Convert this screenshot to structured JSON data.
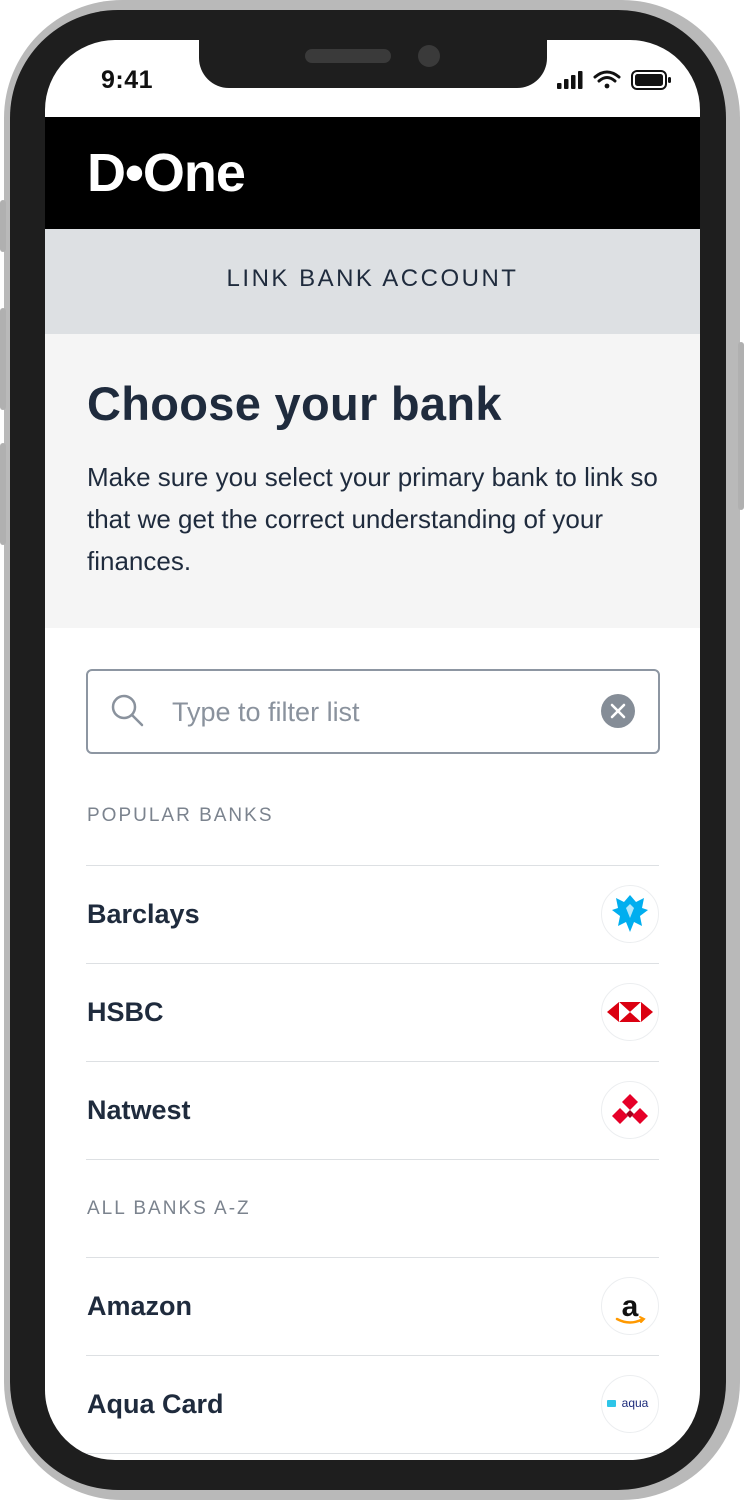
{
  "status_bar": {
    "time": "9:41"
  },
  "header": {
    "logo_text": "D•One"
  },
  "sub_header": {
    "title": "LINK BANK ACCOUNT"
  },
  "intro": {
    "heading": "Choose your bank",
    "body": "Make sure you select your primary bank to link so that we get the correct understanding of your finances."
  },
  "search": {
    "placeholder": "Type to filter list",
    "value": ""
  },
  "popular": {
    "label": "POPULAR BANKS",
    "banks": [
      {
        "name": "Barclays",
        "logo": "barclays-eagle-icon",
        "color": "#00aeef"
      },
      {
        "name": "HSBC",
        "logo": "hsbc-hexagon-icon",
        "color": "#db0011"
      },
      {
        "name": "Natwest",
        "logo": "natwest-cubes-icon",
        "color": "#e60028"
      }
    ]
  },
  "all_banks": {
    "label": "ALL  BANKS  A-Z",
    "banks": [
      {
        "name": "Amazon",
        "logo": "amazon-a-icon",
        "color": "#ff9900"
      },
      {
        "name": "Aqua Card",
        "logo": "aqua-logo",
        "logo_text": "aqua",
        "color": "#1b2a7a"
      }
    ]
  },
  "colors": {
    "header_bg": "#000000",
    "sub_header_bg": "#dde0e3",
    "intro_bg": "#f5f5f5",
    "text": "#1f2b3d"
  }
}
